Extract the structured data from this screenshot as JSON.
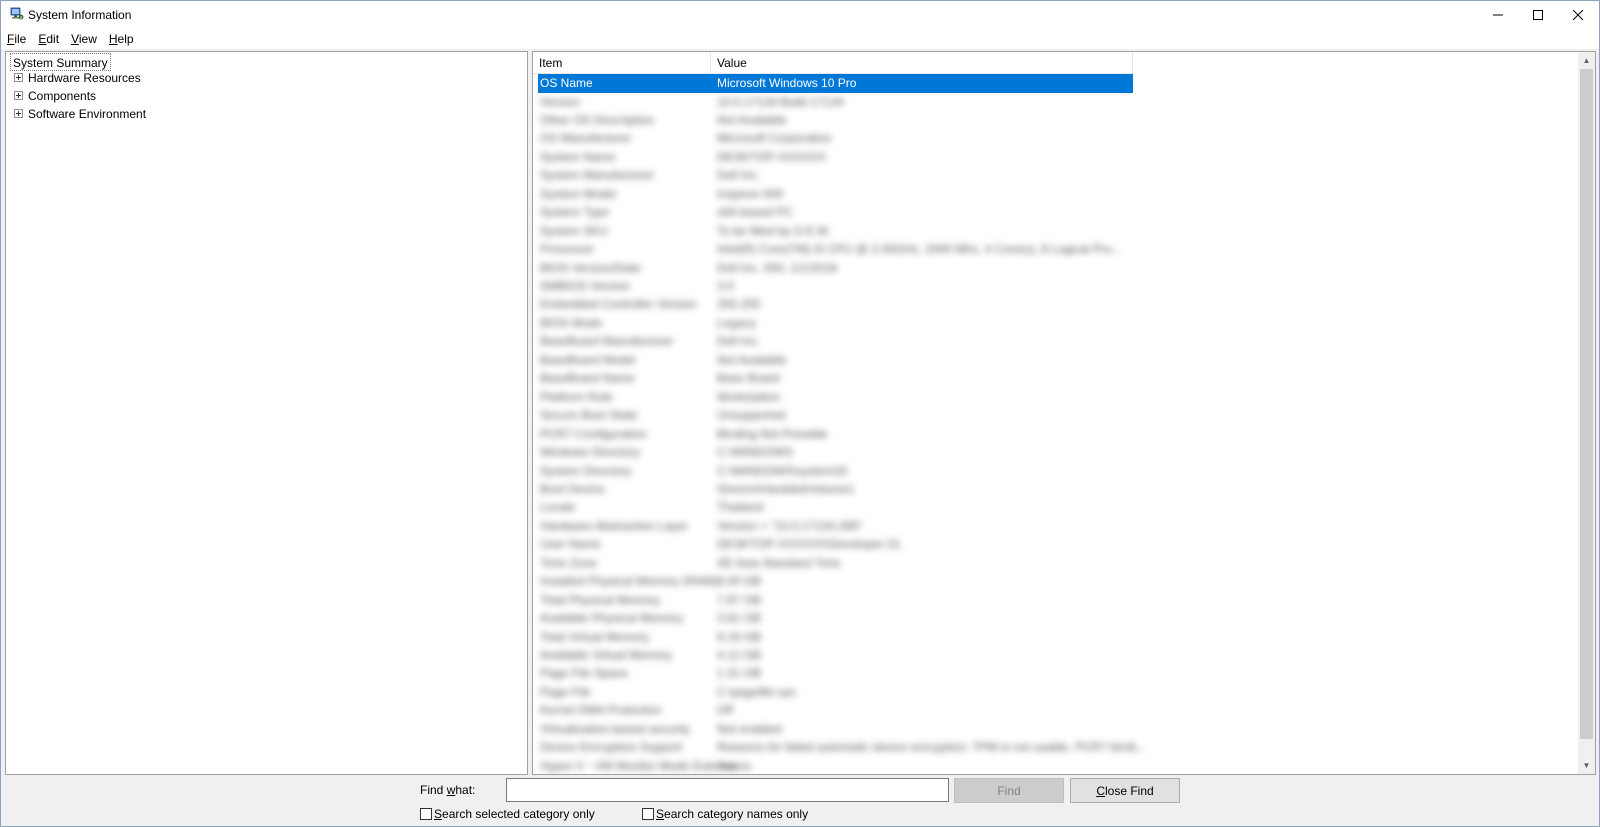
{
  "window": {
    "title": "System Information",
    "controls": {
      "minimize": "—",
      "maximize": "☐",
      "close": "✕"
    }
  },
  "menu": [
    {
      "label": "File",
      "key": "F",
      "rest": "ile"
    },
    {
      "label": "Edit",
      "key": "E",
      "rest": "dit"
    },
    {
      "label": "View",
      "key": "V",
      "rest": "iew"
    },
    {
      "label": "Help",
      "key": "H",
      "rest": "elp"
    }
  ],
  "tree": {
    "root": "System Summary",
    "children": [
      "Hardware Resources",
      "Components",
      "Software Environment"
    ]
  },
  "list": {
    "columns": {
      "item": "Item",
      "value": "Value"
    },
    "selected_row": {
      "item": "OS Name",
      "value": "Microsoft Windows 10 Pro"
    },
    "blurred_rows": [
      {
        "item": "Version",
        "value": "10.0.17134 Build 17134"
      },
      {
        "item": "Other OS Description",
        "value": "Not Available"
      },
      {
        "item": "OS Manufacturer",
        "value": "Microsoft Corporation"
      },
      {
        "item": "System Name",
        "value": "DESKTOP-XXXXXX"
      },
      {
        "item": "System Manufacturer",
        "value": "Dell Inc."
      },
      {
        "item": "System Model",
        "value": "Inspiron 000"
      },
      {
        "item": "System Type",
        "value": "x64-based PC"
      },
      {
        "item": "System SKU",
        "value": "To be filled by O.E.M."
      },
      {
        "item": "Processor",
        "value": "Intel(R) Core(TM) i5 CPU @ 2.00GHz, 2000 Mhz, 4 Core(s), 8 Logical Pro..."
      },
      {
        "item": "BIOS Version/Date",
        "value": "Dell Inc. 000, 1/1/2018"
      },
      {
        "item": "SMBIOS Version",
        "value": "3.0"
      },
      {
        "item": "Embedded Controller Version",
        "value": "255.255"
      },
      {
        "item": "BIOS Mode",
        "value": "Legacy"
      },
      {
        "item": "BaseBoard Manufacturer",
        "value": "Dell Inc."
      },
      {
        "item": "BaseBoard Model",
        "value": "Not Available"
      },
      {
        "item": "BaseBoard Name",
        "value": "Base Board"
      },
      {
        "item": "Platform Role",
        "value": "Workstation"
      },
      {
        "item": "Secure Boot State",
        "value": "Unsupported"
      },
      {
        "item": "PCR7 Configuration",
        "value": "Binding Not Possible"
      },
      {
        "item": "Windows Directory",
        "value": "C:\\WINDOWS"
      },
      {
        "item": "System Directory",
        "value": "C:\\WINDOWS\\system32"
      },
      {
        "item": "Boot Device",
        "value": "\\Device\\HarddiskVolume1"
      },
      {
        "item": "Locale",
        "value": "Thailand"
      },
      {
        "item": "Hardware Abstraction Layer",
        "value": "Version = \"10.0.17134.285\""
      },
      {
        "item": "User Name",
        "value": "DESKTOP-XXXXXX\\Developer 01"
      },
      {
        "item": "Time Zone",
        "value": "SE Asia Standard Time"
      },
      {
        "item": "Installed Physical Memory (RAM)",
        "value": "8.00 GB"
      },
      {
        "item": "Total Physical Memory",
        "value": "7.87 GB"
      },
      {
        "item": "Available Physical Memory",
        "value": "3.81 GB"
      },
      {
        "item": "Total Virtual Memory",
        "value": "9.19 GB"
      },
      {
        "item": "Available Virtual Memory",
        "value": "4.12 GB"
      },
      {
        "item": "Page File Space",
        "value": "1.31 GB"
      },
      {
        "item": "Page File",
        "value": "C:\\pagefile.sys"
      },
      {
        "item": "Kernel DMA Protection",
        "value": "Off"
      },
      {
        "item": "Virtualization-based security",
        "value": "Not enabled"
      },
      {
        "item": "Device Encryption Support",
        "value": "Reasons for failed automatic device encryption: TPM is not usable, PCR7 bindi..."
      },
      {
        "item": "Hyper-V - VM Monitor Mode Extensions",
        "value": "Yes"
      }
    ]
  },
  "find": {
    "label_key": "w",
    "label_pre": "Find ",
    "label_post": "hat:",
    "value": "",
    "find_button": "Find",
    "close_button_key": "C",
    "close_button_rest": "lose Find",
    "chk1_key": "S",
    "chk1_rest": "earch selected category only",
    "chk2_key": "S",
    "chk2_rest": "earch category names only"
  }
}
